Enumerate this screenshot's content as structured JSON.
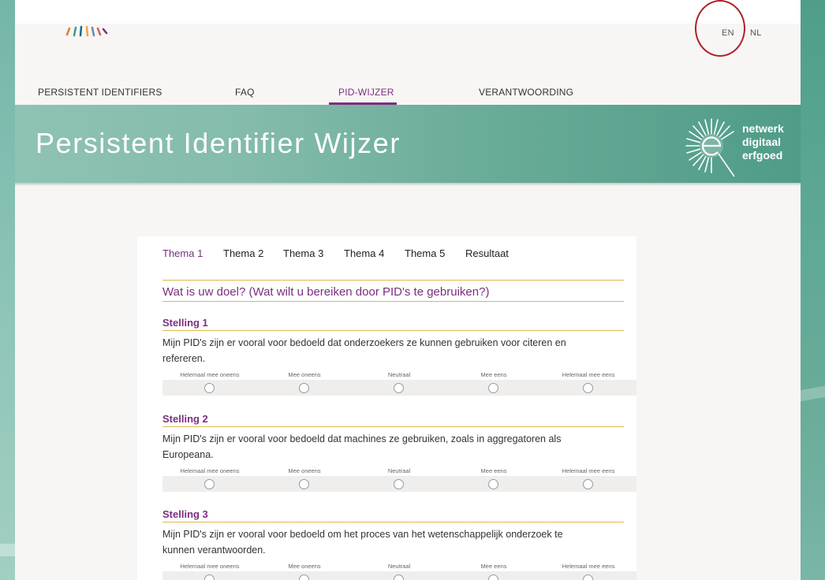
{
  "lang": {
    "en": "EN",
    "nl": "NL"
  },
  "nav": {
    "items": [
      {
        "label": "PERSISTENT IDENTIFIERS"
      },
      {
        "label": "FAQ"
      },
      {
        "label": "PID-WIJZER"
      },
      {
        "label": "VERANTWOORDING"
      }
    ],
    "active_index": 2
  },
  "banner": {
    "title": "Persistent Identifier Wijzer",
    "brand": [
      "netwerk",
      "digitaal",
      "erfgoed"
    ]
  },
  "tabs": [
    "Thema 1",
    "Thema 2",
    "Thema 3",
    "Thema 4",
    "Thema 5",
    "Resultaat"
  ],
  "active_tab": 0,
  "section_title": "Wat is uw doel? (Wat wilt u bereiken door PID's te gebruiken?)",
  "scale_labels": [
    "Helemaal mee oneens",
    "Mee oneens",
    "Neutraal",
    "Mee eens",
    "Helemaal mee eens"
  ],
  "stellingen": [
    {
      "title": "Stelling 1",
      "text": "Mijn PID's zijn er vooral voor bedoeld dat onderzoekers ze kunnen gebruiken voor citeren en refereren."
    },
    {
      "title": "Stelling 2",
      "text": "Mijn PID's zijn er vooral voor bedoeld dat machines ze gebruiken, zoals in aggregatoren als Europeana."
    },
    {
      "title": "Stelling 3",
      "text": "Mijn PID's zijn er vooral voor bedoeld om het proces van het wetenschappelijk onderzoek te kunnen verantwoorden."
    }
  ],
  "colors": {
    "accent_purple": "#7a2f7f",
    "rule_gold": "#e0b84a",
    "banner_teal": "#6aab99",
    "annotation_red": "#b11e2a"
  }
}
